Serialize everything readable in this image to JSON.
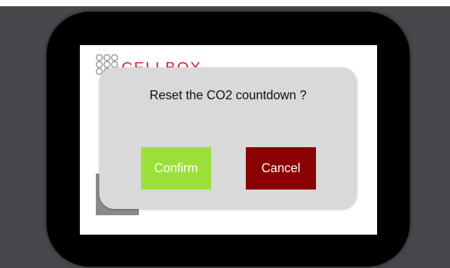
{
  "dialog": {
    "message": "Reset the CO2 countdown ?",
    "confirm_label": "Confirm",
    "cancel_label": "Cancel"
  },
  "logo": {
    "text": "CELLBOX",
    "icon": "cellbox-dots-logo-icon"
  },
  "colors": {
    "backdrop": "#46484c",
    "bezel": "#000000",
    "dialog": "#d9d9d9",
    "confirm": "#9be03a",
    "cancel": "#8b0000",
    "brand": "#d9252b"
  }
}
